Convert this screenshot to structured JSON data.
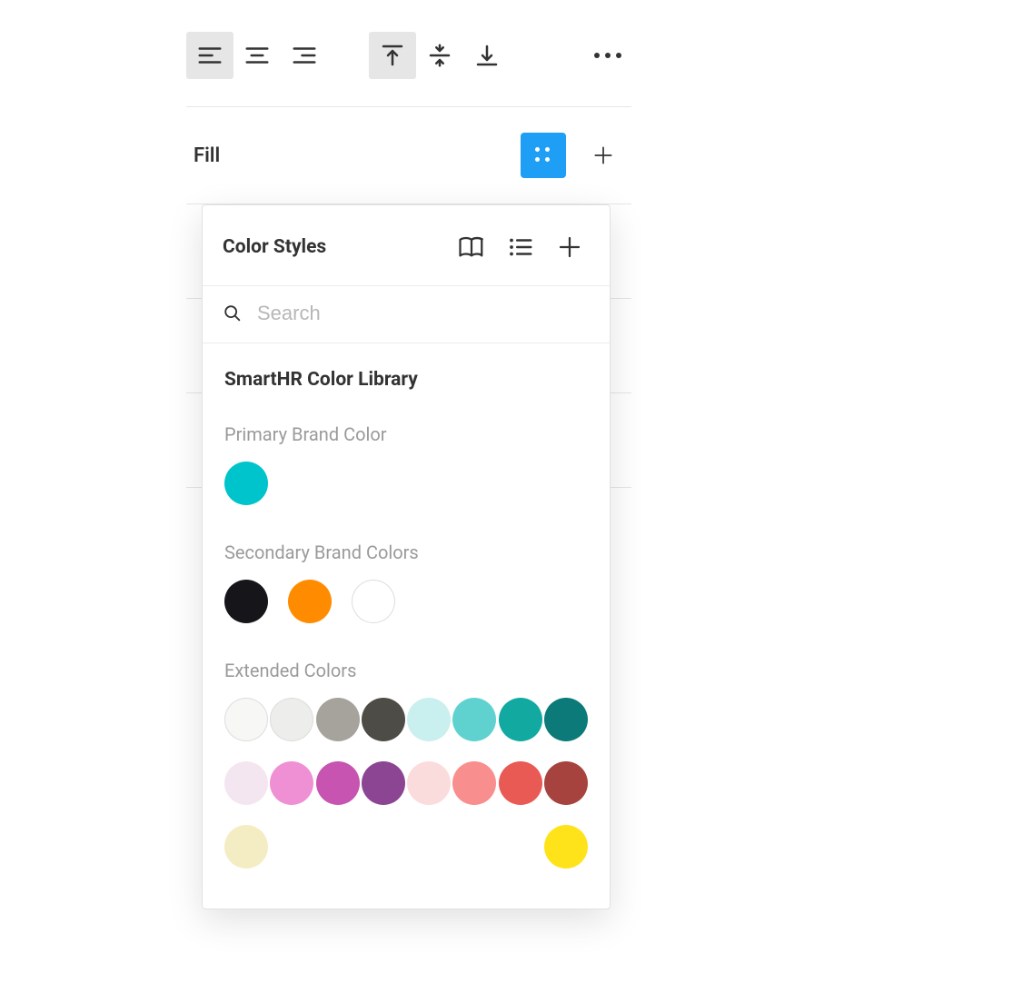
{
  "fill_section": {
    "label": "Fill"
  },
  "flyout": {
    "title": "Color Styles",
    "search_placeholder": "Search",
    "library_name": "SmartHR Color Library",
    "groups": [
      {
        "name": "primary",
        "label": "Primary Brand Color",
        "swatches": [
          {
            "name": "primary-teal",
            "hex": "#00c4cc",
            "border": false
          }
        ]
      },
      {
        "name": "secondary",
        "label": "Secondary Brand Colors",
        "swatches": [
          {
            "name": "black",
            "hex": "#16161a",
            "border": false
          },
          {
            "name": "orange",
            "hex": "#ff8c00",
            "border": false
          },
          {
            "name": "white",
            "hex": "#ffffff",
            "border": true
          }
        ]
      },
      {
        "name": "extended",
        "label": "Extended Colors",
        "swatches": [
          {
            "name": "grey-05",
            "hex": "#f7f7f6",
            "border": true
          },
          {
            "name": "grey-10",
            "hex": "#ededeb",
            "border": true
          },
          {
            "name": "grey-40",
            "hex": "#a5a39c",
            "border": false
          },
          {
            "name": "grey-70",
            "hex": "#4e4c46",
            "border": false
          },
          {
            "name": "aqua-light",
            "hex": "#c9efee",
            "border": false
          },
          {
            "name": "aqua",
            "hex": "#5fd2d0",
            "border": false
          },
          {
            "name": "teal",
            "hex": "#12a9a1",
            "border": false
          },
          {
            "name": "teal-dark",
            "hex": "#0b7a78",
            "border": false
          },
          {
            "name": "pink-05",
            "hex": "#f4e6f1",
            "border": false
          },
          {
            "name": "pink-40",
            "hex": "#ef8fd4",
            "border": false
          },
          {
            "name": "magenta",
            "hex": "#c654b0",
            "border": false
          },
          {
            "name": "purple",
            "hex": "#8b4592",
            "border": false
          },
          {
            "name": "rose-05",
            "hex": "#fbdcdc",
            "border": false
          },
          {
            "name": "coral",
            "hex": "#f98e8e",
            "border": false
          },
          {
            "name": "red",
            "hex": "#e85a53",
            "border": false
          },
          {
            "name": "maroon",
            "hex": "#a7433f",
            "border": false
          },
          {
            "name": "cream",
            "hex": "#f4edc3",
            "border": false
          },
          {
            "name": "yellow",
            "hex": "#ffe31a",
            "border": false
          }
        ]
      }
    ]
  }
}
